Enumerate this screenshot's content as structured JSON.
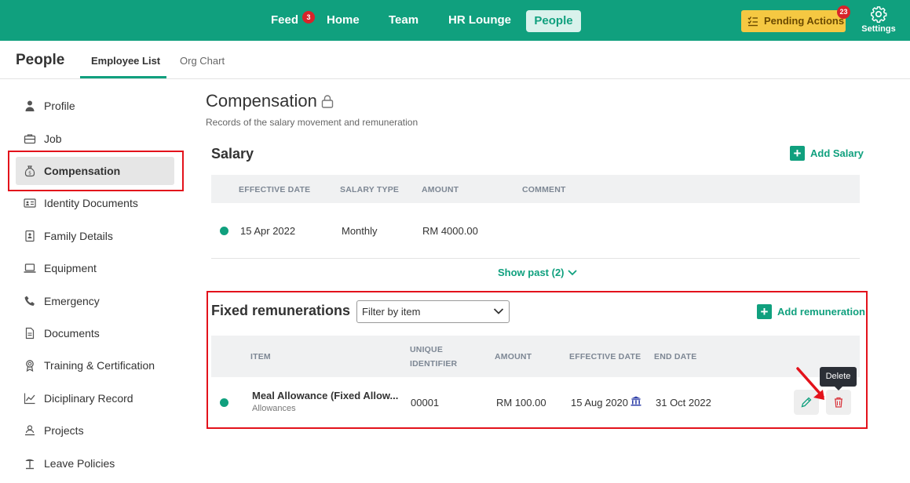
{
  "topnav": {
    "items": [
      {
        "label": "Feed",
        "badge": "3"
      },
      {
        "label": "Home"
      },
      {
        "label": "Team"
      },
      {
        "label": "HR Lounge"
      },
      {
        "label": "People"
      }
    ],
    "pending_actions": {
      "label": "Pending Actions",
      "badge": "23"
    },
    "settings_label": "Settings",
    "brand_color": "#10a07e"
  },
  "subheader": {
    "title": "People",
    "tabs": [
      {
        "label": "Employee List",
        "active": true
      },
      {
        "label": "Org Chart",
        "active": false
      }
    ]
  },
  "sidebar": {
    "items": [
      {
        "label": "Profile",
        "icon": "person-icon"
      },
      {
        "label": "Job",
        "icon": "briefcase-icon"
      },
      {
        "label": "Compensation",
        "icon": "money-bag-icon",
        "active": true
      },
      {
        "label": "Identity Documents",
        "icon": "id-card-icon"
      },
      {
        "label": "Family Details",
        "icon": "family-icon"
      },
      {
        "label": "Equipment",
        "icon": "laptop-icon"
      },
      {
        "label": "Emergency",
        "icon": "phone-icon"
      },
      {
        "label": "Documents",
        "icon": "document-icon"
      },
      {
        "label": "Training & Certification",
        "icon": "award-icon"
      },
      {
        "label": "Diciplinary Record",
        "icon": "chart-icon"
      },
      {
        "label": "Projects",
        "icon": "projects-icon"
      },
      {
        "label": "Leave Policies",
        "icon": "beach-icon"
      }
    ]
  },
  "main": {
    "title": "Compensation",
    "subtitle": "Records of the salary movement and remuneration",
    "salary": {
      "title": "Salary",
      "add_label": "Add Salary",
      "columns": [
        "EFFECTIVE DATE",
        "SALARY TYPE",
        "AMOUNT",
        "COMMENT"
      ],
      "rows": [
        {
          "effective_date": "15 Apr 2022",
          "salary_type": "Monthly",
          "amount": "RM 4000.00",
          "comment": ""
        }
      ],
      "show_past_label": "Show past (2)"
    },
    "fixed": {
      "title": "Fixed remunerations",
      "filter_placeholder": "Filter by item",
      "add_label": "Add remuneration",
      "columns": {
        "item": "ITEM",
        "unique_1": "UNIQUE",
        "unique_2": "IDENTIFIER",
        "amount": "AMOUNT",
        "effective_date": "EFFECTIVE DATE",
        "end_date": "END DATE"
      },
      "rows": [
        {
          "item": "Meal Allowance (Fixed Allow...",
          "category": "Allowances",
          "unique_identifier": "00001",
          "amount": "RM 100.00",
          "effective_date": "15 Aug 2020",
          "end_date": "31 Oct 2022"
        }
      ],
      "tooltip": "Delete"
    }
  }
}
